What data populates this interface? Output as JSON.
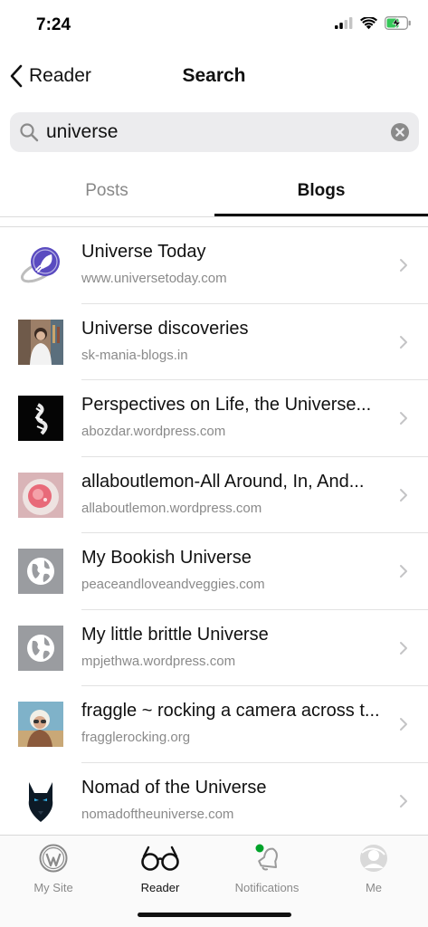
{
  "status_bar": {
    "time": "7:24",
    "icons": [
      "signal-icon",
      "wifi-icon",
      "battery-charging-icon"
    ],
    "battery_color": "#35c759"
  },
  "nav": {
    "back_label": "Reader",
    "title": "Search"
  },
  "search": {
    "value": "universe",
    "placeholder": "",
    "icon": "search-icon",
    "clear_icon": "clear-icon"
  },
  "tabs": [
    {
      "label": "Posts",
      "selected": false
    },
    {
      "label": "Blogs",
      "selected": true
    }
  ],
  "blogs": [
    {
      "title": "Universe Today",
      "url": "www.universetoday.com",
      "thumb": "rocket-logo"
    },
    {
      "title": "Universe discoveries",
      "url": "sk-mania-blogs.in",
      "thumb": "photo-person"
    },
    {
      "title": "Perspectives on Life, the Universe...",
      "url": "abozdar.wordpress.com",
      "thumb": "photo-dark-abstract"
    },
    {
      "title": "allaboutlemon-All Around, In, And...",
      "url": "allaboutlemon.wordpress.com",
      "thumb": "photo-drink"
    },
    {
      "title": "My Bookish Universe",
      "url": "peaceandloveandveggies.com",
      "thumb": "globe-placeholder"
    },
    {
      "title": "My little brittle Universe",
      "url": "mpjethwa.wordpress.com",
      "thumb": "globe-placeholder"
    },
    {
      "title": "fraggle ~ rocking a camera across t...",
      "url": "fragglerocking.org",
      "thumb": "photo-portrait"
    },
    {
      "title": "Nomad of the Universe",
      "url": "nomadoftheuniverse.com",
      "thumb": "wolf-logo"
    }
  ],
  "tab_bar": [
    {
      "label": "My Site",
      "icon": "wordpress-icon",
      "active": false
    },
    {
      "label": "Reader",
      "icon": "reader-glasses-icon",
      "active": true
    },
    {
      "label": "Notifications",
      "icon": "bell-icon",
      "active": false,
      "badge_color": "#00a32a"
    },
    {
      "label": "Me",
      "icon": "avatar-icon",
      "active": false
    }
  ],
  "colors": {
    "accent": "#111111",
    "secondary_text": "#8a8a8a",
    "search_bg": "#ececee"
  }
}
